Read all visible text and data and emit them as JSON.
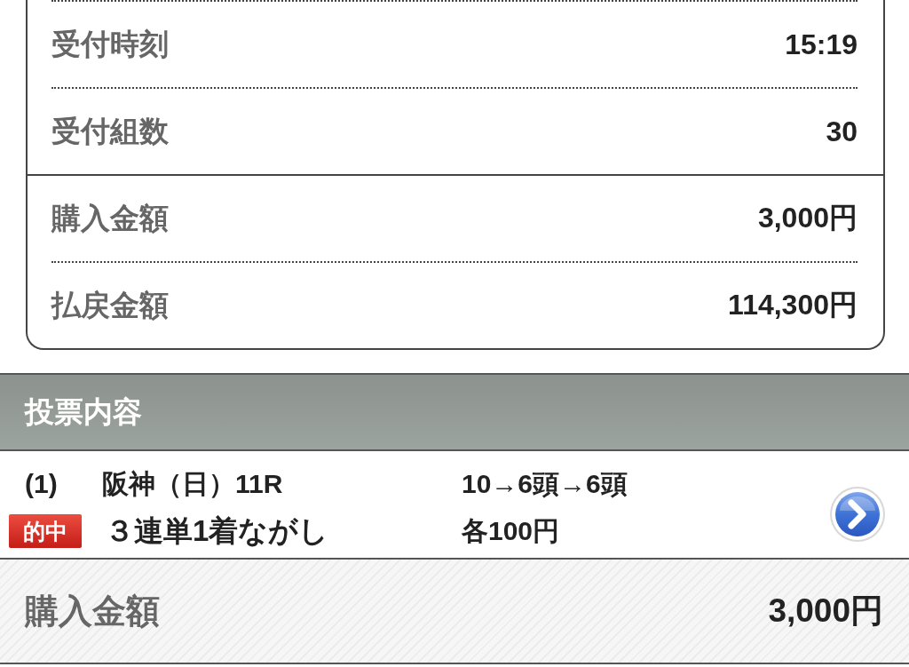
{
  "summary": {
    "sections": [
      {
        "rows": [
          {
            "label": "受付時刻",
            "value": "15:19"
          },
          {
            "label": "受付組数",
            "value": "30"
          }
        ]
      },
      {
        "rows": [
          {
            "label": "購入金額",
            "value": "3,000円"
          },
          {
            "label": "払戻金額",
            "value": "114,300円"
          }
        ]
      }
    ]
  },
  "bet_details": {
    "title": "投票内容",
    "bets": [
      {
        "number": "(1)",
        "venue": "阪神（日）11R",
        "selection": "10→6頭→6頭",
        "badge": "的中",
        "bet_type": "３連単1着ながし",
        "amount": "各100円"
      }
    ]
  },
  "total": {
    "label": "購入金額",
    "value": "3,000円"
  }
}
